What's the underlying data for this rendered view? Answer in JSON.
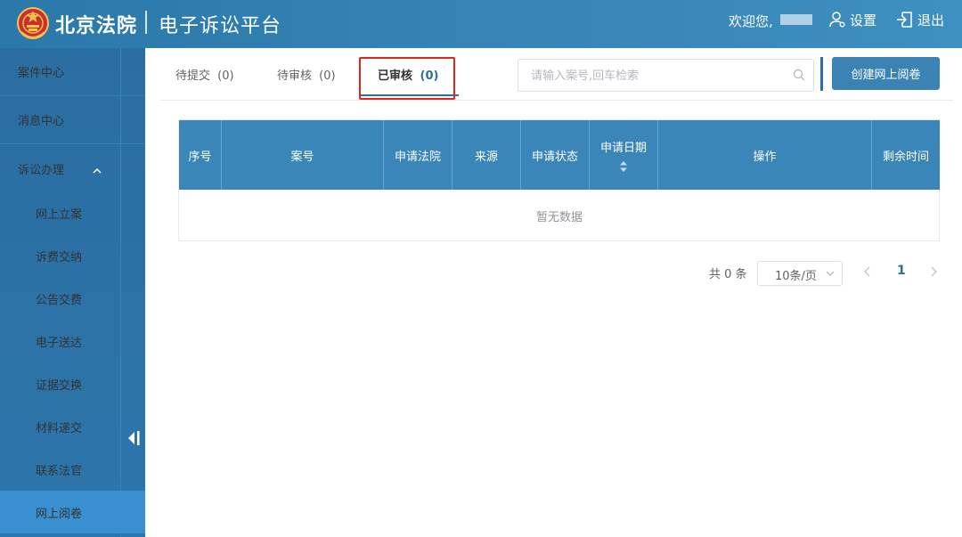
{
  "header": {
    "brand": "北京法院",
    "platform": "电子诉讼平台",
    "welcome": "欢迎您,",
    "settings_label": "设置",
    "logout_label": "退出"
  },
  "sidebar": {
    "items": [
      {
        "label": "案件中心"
      },
      {
        "label": "消息中心"
      },
      {
        "label": "诉讼办理"
      }
    ],
    "sub_items": [
      {
        "label": "网上立案"
      },
      {
        "label": "诉费交纳"
      },
      {
        "label": "公告交费"
      },
      {
        "label": "电子送达"
      },
      {
        "label": "证据交换"
      },
      {
        "label": "材料递交"
      },
      {
        "label": "联系法官"
      },
      {
        "label": "网上阅卷",
        "active": true
      }
    ]
  },
  "tabs": [
    {
      "label": "待提交",
      "count": "(0)"
    },
    {
      "label": "待审核",
      "count": "(0)"
    },
    {
      "label": "已审核",
      "count": "(0)",
      "active": true
    }
  ],
  "search": {
    "placeholder": "请输入案号,回车检索",
    "value": ""
  },
  "actions": {
    "create_label": "创建网上阅卷"
  },
  "table": {
    "columns": [
      "序号",
      "案号",
      "申请法院",
      "来源",
      "申请状态",
      "申请日期",
      "操作",
      "剩余时间"
    ],
    "empty_text": "暂无数据"
  },
  "pagination": {
    "total": "共 0 条",
    "page_size": "10条/页",
    "current_page": "1"
  },
  "colors": {
    "header_bg": "#2b78aa",
    "sidebar_bg": "#2a6da1",
    "active_item": "#3a8fd0",
    "table_header": "#3a86b8",
    "primary": "#2b6fa4",
    "highlight_border": "#e0251e"
  }
}
